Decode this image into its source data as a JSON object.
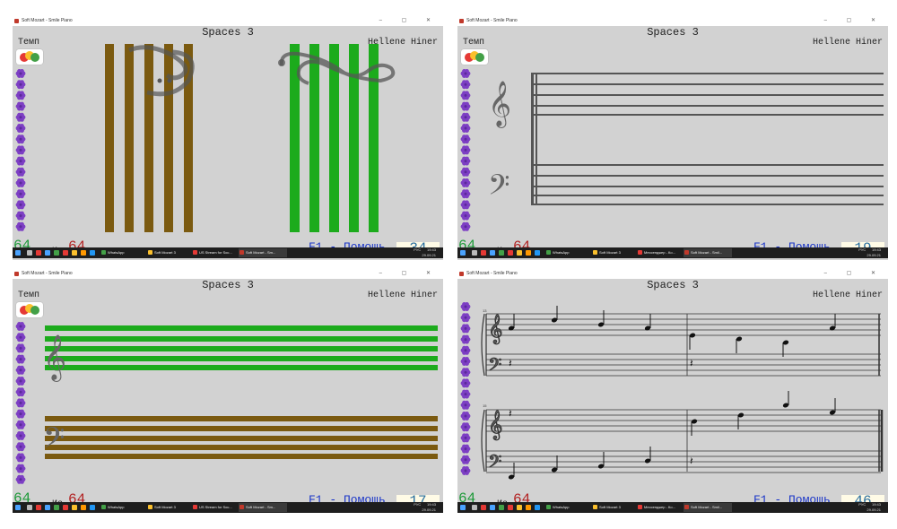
{
  "window": {
    "title_a": "Soft Mozart - Smile Piano",
    "title_b": "Soft Mozart - Smile Piano",
    "controls": "– ▢ ✕"
  },
  "page_title": "Spaces 3",
  "author": "Hellene Hiner",
  "tempo_label": "Темп",
  "of_label": "Из",
  "help_label": "F1 - Помощь",
  "panels": [
    {
      "correct": "64",
      "total": "64",
      "counter": "34"
    },
    {
      "correct": "64",
      "total": "64",
      "counter": "19"
    },
    {
      "correct": "64",
      "total": "64",
      "counter": "17"
    },
    {
      "correct": "64",
      "total": "64",
      "counter": "46"
    }
  ],
  "measures": [
    "13",
    "15"
  ],
  "taskbar": {
    "apps_a": [
      "WhatsApp",
      "Soft Mozart 3",
      "US Stream for Soc...",
      "Soft Mozart - Sm..."
    ],
    "apps_b": [
      "WhatsApp",
      "Soft Mozart 3",
      "Мессенджер - Ко...",
      "Soft Mozart - Smil..."
    ],
    "lang": "РУС",
    "time": "19:43",
    "date": "29.09.21"
  },
  "colors": {
    "panel_bg": "#d2d2d2",
    "green": "#1cab1c",
    "brown": "#7b5a10",
    "help_blue": "#1a35c8",
    "counter_teal": "#2a6fa0",
    "correct_green": "#1f9a3a",
    "total_red": "#b22222",
    "flower_purple": "#7d3fc4"
  }
}
